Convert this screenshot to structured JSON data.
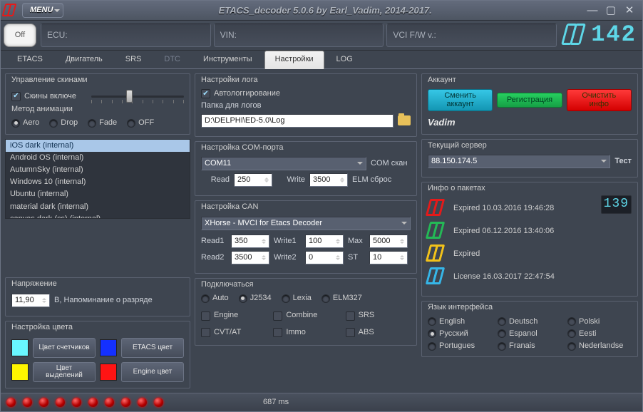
{
  "title": "ETACS_decoder 5.0.6 by Earl_Vadim, 2014-2017.",
  "menu_label": "MENU",
  "off_label": "Off",
  "head_fields": {
    "ecu": "ECU:",
    "vin": "VIN:",
    "vci": "VCI F/W v.:"
  },
  "head_counter": "142",
  "tabs": [
    "ETACS",
    "Двигатель",
    "SRS",
    "DTC",
    "Инструменты",
    "Настройки",
    "LOG"
  ],
  "skins": {
    "title": "Управление скинами",
    "enable": "Скины включе",
    "anim_title": "Метод анимации",
    "anim_options": [
      "Aero",
      "Drop",
      "Fade",
      "OFF"
    ],
    "list": [
      "iOS dark (internal)",
      "Android OS (internal)",
      "AutumnSky (internal)",
      "Windows 10 (internal)",
      "Ubuntu (internal)",
      "material dark (internal)",
      "canvas dark (cs) (internal)"
    ]
  },
  "voltage": {
    "title": "Напряжение",
    "value": "11,90",
    "note": "В, Напоминание о разряде"
  },
  "colors": {
    "title": "Настройка цвета",
    "counter": {
      "label": "Цвет счетчиков",
      "swatch": "#69f7ff"
    },
    "etacs": {
      "label": "ETACS цвет",
      "swatch": "#1430ff"
    },
    "highlight": {
      "label": "Цвет выделений",
      "swatch": "#fff500"
    },
    "engine": {
      "label": "Engine цвет",
      "swatch": "#ff1414"
    }
  },
  "log": {
    "title": "Настройки лога",
    "auto": "Автологгирование",
    "folder_label": "Папка для логов",
    "folder": "D:\\DELPHI\\ED-5.0\\Log"
  },
  "com": {
    "title": "Настройка COM-порта",
    "port": "COM11",
    "scan": "COM скан",
    "read_label": "Read",
    "read": "250",
    "write_label": "Write",
    "write": "3500",
    "reset": "ELM сброс"
  },
  "can": {
    "title": "Настройка CAN",
    "device": "XHorse - MVCI for Etacs Decoder",
    "r1_label": "Read1",
    "r1": "350",
    "w1_label": "Write1",
    "w1": "100",
    "max_label": "Max",
    "max": "5000",
    "r2_label": "Read2",
    "r2": "3500",
    "w2_label": "Write2",
    "w2": "0",
    "st_label": "ST",
    "st": "10"
  },
  "connect": {
    "title": "Подключаться",
    "modes": [
      "Auto",
      "J2534",
      "Lexia",
      "ELM327"
    ],
    "checks": [
      "Engine",
      "Combine",
      "SRS",
      "CVT/AT",
      "Immo",
      "ABS"
    ]
  },
  "account": {
    "title": "Аккаунт",
    "change": "Сменить аккаунт",
    "register": "Регистрация",
    "clear": "Очистить инфо",
    "user": "Vadim"
  },
  "server": {
    "title": "Текущий сервер",
    "value": "88.150.174.5",
    "test": "Тест"
  },
  "packets": {
    "title": "Инфо о пакетах",
    "count": "139",
    "items": [
      {
        "text": "Expired 10.03.2016 19:46:28",
        "color": "#e51a1a"
      },
      {
        "text": "Expired 06.12.2016 13:40:06",
        "color": "#24b956"
      },
      {
        "text": "Expired",
        "color": "#f2c21a"
      },
      {
        "text": "License 16.03.2017 22:47:54",
        "color": "#36b6e8"
      }
    ]
  },
  "lang": {
    "title": "Язык интерфейса",
    "options": [
      "English",
      "Deutsch",
      "Polski",
      "Русский",
      "Espanol",
      "Eesti",
      "Portugues",
      "Franais",
      "Nederlandse"
    ]
  },
  "status_ms": "687 ms"
}
